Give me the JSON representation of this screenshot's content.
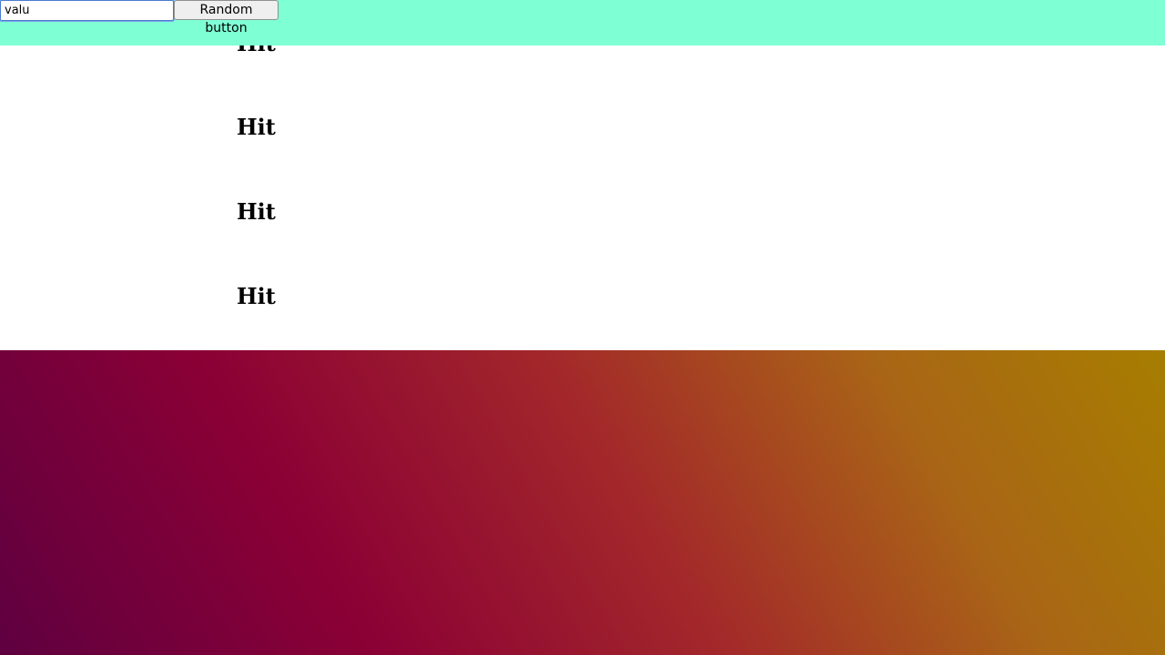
{
  "controls": {
    "input_value": "valu",
    "button_label": "Random button"
  },
  "content": {
    "headings": [
      "Hit",
      "Hit",
      "Hit",
      "Hit"
    ]
  },
  "colors": {
    "top_bar": "#7fffd4",
    "content_background": "#ffffff",
    "gradient_start": "#5f0040",
    "gradient_end": "#a77e00"
  }
}
